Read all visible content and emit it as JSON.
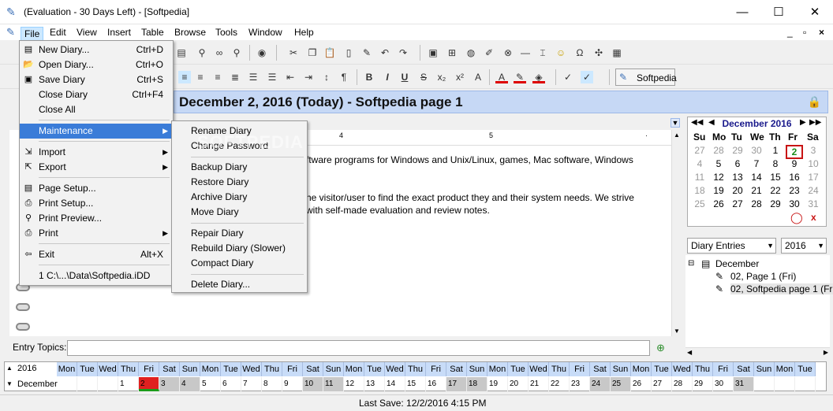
{
  "window": {
    "title": "(Evaluation - 30 Days Left) - [Softpedia]",
    "minimize": "—",
    "maximize": "☐",
    "close": "✕",
    "doc_min": "_",
    "doc_restore": "▫",
    "doc_close": "×"
  },
  "menubar": {
    "items": [
      "File",
      "Edit",
      "View",
      "Insert",
      "Table",
      "Browse",
      "Tools",
      "Window",
      "Help"
    ]
  },
  "toolbar": {
    "softpedia_label": "Softpedia"
  },
  "header": {
    "date_title": "December 2, 2016 (Today) - Softpedia page 1"
  },
  "document": {
    "line1": "ftware programs for Windows and Unix/Linux, games, Mac software, Windows",
    "line2": "he visitor/user to find the exact product they and their system needs. We strive",
    "line3": "with self-made evaluation and review notes.",
    "watermark": "SOFTPEDIA"
  },
  "file_menu": {
    "items": [
      {
        "label": "New Diary...",
        "shortcut": "Ctrl+D",
        "icon": "new-diary-icon"
      },
      {
        "label": "Open Diary...",
        "shortcut": "Ctrl+O",
        "icon": "open-diary-icon"
      },
      {
        "label": "Save Diary",
        "shortcut": "Ctrl+S",
        "icon": "save-icon"
      },
      {
        "label": "Close Diary",
        "shortcut": "Ctrl+F4",
        "icon": ""
      },
      {
        "label": "Close All",
        "shortcut": "",
        "icon": ""
      }
    ],
    "maintenance": "Maintenance",
    "import": "Import",
    "export": "Export",
    "page_setup": "Page Setup...",
    "print_setup": "Print Setup...",
    "print_preview": "Print Preview...",
    "print": "Print",
    "exit": "Exit",
    "exit_shortcut": "Alt+X",
    "recent": "1 C:\\...\\Data\\Softpedia.iDD"
  },
  "maintenance_menu": {
    "group1": [
      "Rename Diary",
      "Change Password"
    ],
    "group2": [
      "Backup Diary",
      "Restore Diary",
      "Archive Diary",
      "Move Diary"
    ],
    "group3": [
      "Repair Diary",
      "Rebuild Diary (Slower)",
      "Compact Diary"
    ],
    "group4": [
      "Delete Diary..."
    ]
  },
  "calendar": {
    "month_label": "December 2016",
    "days_of_week": [
      "Su",
      "Mo",
      "Tu",
      "We",
      "Th",
      "Fr",
      "Sa"
    ],
    "weeks": [
      [
        "27",
        "28",
        "29",
        "30",
        "1",
        "2",
        "3"
      ],
      [
        "4",
        "5",
        "6",
        "7",
        "8",
        "9",
        "10"
      ],
      [
        "11",
        "12",
        "13",
        "14",
        "15",
        "16",
        "17"
      ],
      [
        "18",
        "19",
        "20",
        "21",
        "22",
        "23",
        "24"
      ],
      [
        "25",
        "26",
        "27",
        "28",
        "29",
        "30",
        "31"
      ]
    ],
    "today": "2"
  },
  "entries": {
    "filter": "Diary Entries",
    "year": "2016",
    "tree_root": "December",
    "tree_items": [
      "02, Page 1 (Fri)",
      "02, Softpedia page 1 (Fri)"
    ]
  },
  "topics": {
    "label": "Entry Topics:",
    "value": ""
  },
  "strip": {
    "year": "2016",
    "month": "December",
    "weekdays": [
      "Mon",
      "Tue",
      "Wed",
      "Thu",
      "Fri",
      "Sat",
      "Sun",
      "Mon",
      "Tue",
      "Wed",
      "Thu",
      "Fri",
      "Sat",
      "Sun",
      "Mon",
      "Tue",
      "Wed",
      "Thu",
      "Fri",
      "Sat",
      "Sun",
      "Mon",
      "Tue",
      "Wed",
      "Thu",
      "Fri",
      "Sat",
      "Sun",
      "Mon",
      "Tue",
      "Wed",
      "Thu",
      "Fri",
      "Sat",
      "Sun",
      "Mon",
      "Tue"
    ],
    "days": [
      "",
      "",
      "",
      "1",
      "2",
      "3",
      "4",
      "5",
      "6",
      "7",
      "8",
      "9",
      "10",
      "11",
      "12",
      "13",
      "14",
      "15",
      "16",
      "17",
      "18",
      "19",
      "20",
      "21",
      "22",
      "23",
      "24",
      "25",
      "26",
      "27",
      "28",
      "29",
      "30",
      "31",
      "",
      "",
      ""
    ]
  },
  "status": {
    "last_save": "Last Save: 12/2/2016 4:15 PM"
  }
}
